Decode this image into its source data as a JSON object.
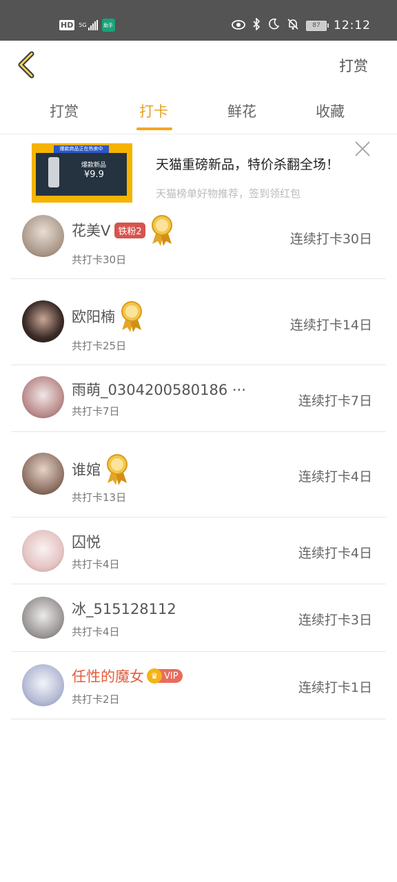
{
  "status_bar": {
    "hd": "HD",
    "network": "5G",
    "app_badge": "助手",
    "battery": "87",
    "time": "12:12"
  },
  "header": {
    "right_action": "打赏"
  },
  "tabs": [
    {
      "label": "打赏"
    },
    {
      "label": "打卡"
    },
    {
      "label": "鲜花"
    },
    {
      "label": "收藏"
    }
  ],
  "ad": {
    "banner": "爆款商品正在热卖中",
    "product_label": "爆款新品",
    "price": "¥9.9",
    "title": "天猫重磅新品，特价杀翻全场！",
    "subtitle": "天猫榜单好物推荐，签到领红包"
  },
  "rows": [
    {
      "name": "花美V",
      "badge": "铁粉2",
      "medal": true,
      "total": "共打卡30日",
      "streak": "连续打卡30日"
    },
    {
      "name": "欧阳楠",
      "medal": true,
      "total": "共打卡25日",
      "streak": "连续打卡14日"
    },
    {
      "name": "雨萌_0304200580186 ···",
      "total": "共打卡7日",
      "streak": "连续打卡7日"
    },
    {
      "name": "谁婠",
      "medal": true,
      "total": "共打卡13日",
      "streak": "连续打卡4日"
    },
    {
      "name": "囚悦",
      "total": "共打卡4日",
      "streak": "连续打卡4日"
    },
    {
      "name": "冰_515128112",
      "total": "共打卡4日",
      "streak": "连续打卡3日"
    },
    {
      "name": "任性的魔女",
      "vip": "VIP",
      "total": "共打卡2日",
      "streak": "连续打卡1日"
    }
  ],
  "colors": {
    "accent": "#f5a623",
    "vip_name": "#e35d3d",
    "statusbar": "#545454"
  }
}
